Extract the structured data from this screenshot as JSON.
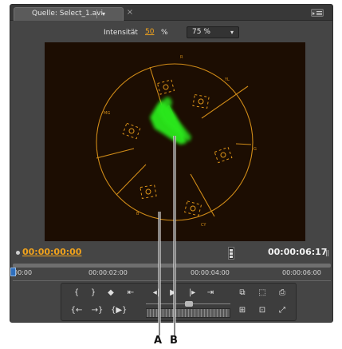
{
  "tab": {
    "title": "Quelle: Select_1.avi",
    "menu_caret": "▾",
    "close": "×"
  },
  "options": {
    "intensity_label": "Intensität",
    "intensity_value": "50",
    "intensity_unit": "%",
    "zoom_value": "75 %",
    "zoom_caret": "▾"
  },
  "vectorscope": {
    "targets": [
      "R",
      "MG",
      "B",
      "CY",
      "G",
      "YL"
    ],
    "labels": {
      "r": "R",
      "mg": "MG",
      "b": "B",
      "cy": "CY",
      "g": "G",
      "yl": "YL"
    },
    "trace_color": "#29e81c",
    "graticule_color": "#f0a21c"
  },
  "timecode": {
    "current": "00:00:00:00",
    "duration": "00:00:06:17"
  },
  "ruler": {
    "labels": [
      "00:00",
      "00:00:02:00",
      "00:00:04:00",
      "00:00:06:00"
    ]
  },
  "controls": {
    "row1": [
      "{",
      "}",
      "◆",
      "⇤",
      "◂|",
      "▶",
      "|▸",
      "⇥",
      "⧉",
      "⬚",
      "⎙"
    ],
    "row2": [
      "{←",
      "→}",
      "{▶}",
      "⊞",
      "⊡",
      "⤢"
    ]
  },
  "callouts": {
    "a": "A",
    "b": "B"
  },
  "colors": {
    "accent": "#f0a21c",
    "panel": "#454545"
  }
}
